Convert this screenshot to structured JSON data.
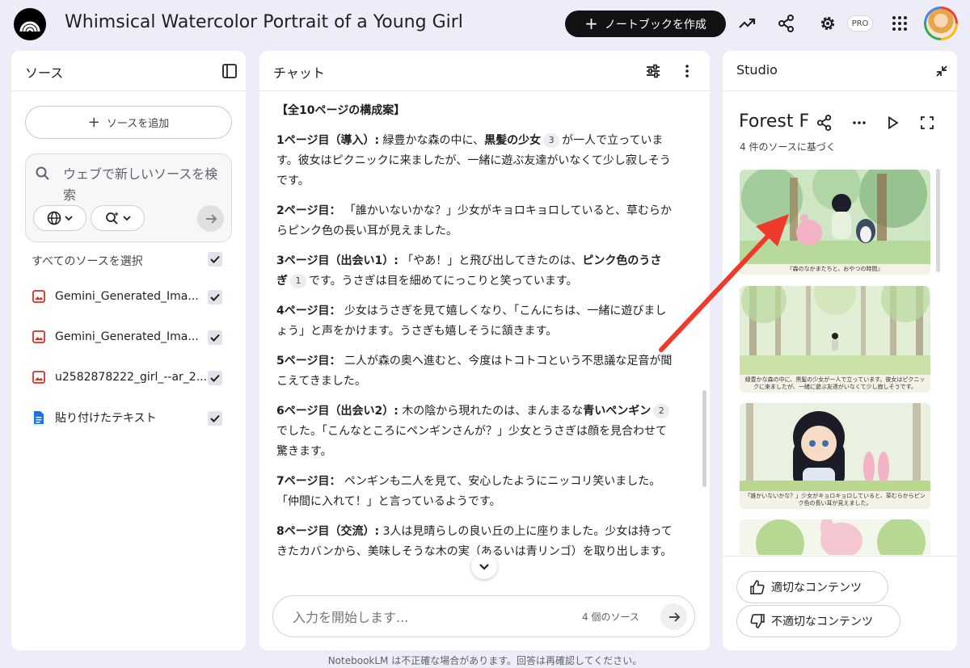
{
  "header": {
    "title": "Whimsical Watercolor Portrait of a Young Girl",
    "create_notebook": "ノートブックを作成",
    "pro_badge": "PRO"
  },
  "sources": {
    "title": "ソース",
    "add_source": "ソースを追加",
    "search_placeholder": "ウェブで新しいソースを検索",
    "select_all": "すべてのソースを選択",
    "items": [
      {
        "label": "Gemini_Generated_Ima...",
        "type": "image",
        "checked": true
      },
      {
        "label": "Gemini_Generated_Ima...",
        "type": "image",
        "checked": true
      },
      {
        "label": "u2582878222_girl_--ar_2...",
        "type": "image",
        "checked": true
      },
      {
        "label": "貼り付けたテキスト",
        "type": "text",
        "checked": true
      }
    ]
  },
  "chat": {
    "title": "チャット",
    "heading": "【全10ページの構成案】",
    "paragraphs": [
      {
        "head": "1ページ目（導入）:",
        "a": " 緑豊かな森の中に、",
        "bold": "黒髪の少女",
        "cite": "3",
        "b": "が一人で立っています。彼女はピクニックに来ましたが、一緒に遊ぶ友達がいなくて少し寂しそうです。"
      },
      {
        "head": "2ページ目：",
        "a": " 「誰かいないかな？」少女がキョロキョロしていると、草むらからピンク色の長い耳が見えました。"
      },
      {
        "head": "3ページ目（出会い1）:",
        "a": " 「やあ！」と飛び出してきたのは、",
        "bold": "ピンク色のうさぎ",
        "cite": "1",
        "b": "です。うさぎは目を細めてにっこりと笑っています。"
      },
      {
        "head": "4ページ目：",
        "a": " 少女はうさぎを見て嬉しくなり、「こんにちは、一緒に遊びましょう」と声をかけます。うさぎも嬉しそうに頷きます。"
      },
      {
        "head": "5ページ目：",
        "a": " 二人が森の奥へ進むと、今度はトコトコという不思議な足音が聞こえてきました。"
      },
      {
        "head": "6ページ目（出会い2）:",
        "a": " 木の陰から現れたのは、まんまるな",
        "bold": "青いペンギン",
        "cite": "2",
        "b": "でした。「こんなところにペンギンさんが？」少女とうさぎは顔を見合わせて驚きます。"
      },
      {
        "head": "7ページ目：",
        "a": " ペンギンも二人を見て、安心したようにニッコリ笑いました。「仲間に入れて！」と言っているようです。"
      },
      {
        "head": "8ページ目（交流）:",
        "a": " 3人は見晴らしの良い丘の上に座りました。少女は持ってきたカバンから、美味しそうな木の実（あるいは青リンゴ）を取り出します。"
      }
    ],
    "input_placeholder": "入力を開始します...",
    "source_count": "4 個のソース"
  },
  "studio": {
    "title": "Studio",
    "note_title": "Forest F",
    "note_subtitle": "4 件のソースに基づく",
    "thumbnails": [
      {
        "caption": "『森のなかまたちと、おやつの時間』"
      },
      {
        "caption": "緑豊かな森の中に、黒髪の少女が一人で立っています。彼女はピクニックに来ましたが、一緒に遊ぶ友達がいなくて少し寂しそうです。"
      },
      {
        "caption": "「誰かいないかな？」少女がキョロキョロしていると、草むらからピンク色の長い耳が見えました。"
      }
    ],
    "feedback_good": "適切なコンテンツ",
    "feedback_bad": "不適切なコンテンツ"
  },
  "footer": {
    "disclaimer": "NotebookLM は不正確な場合があります。回答は再確認してください。"
  },
  "colors": {
    "background": "#ecedf8",
    "primary_button": "#121212",
    "annotation_arrow": "#ee3a2a",
    "source_image_icon": "#d93025",
    "source_text_icon": "#1a73e8"
  }
}
